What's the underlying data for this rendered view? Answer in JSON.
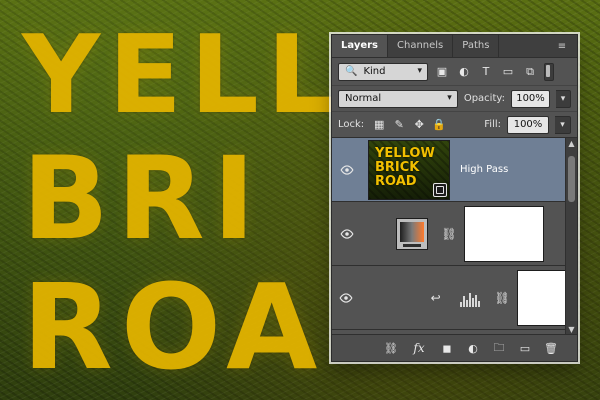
{
  "canvas": {
    "lines": [
      "YELL",
      "BRI",
      "ROA"
    ]
  },
  "panel": {
    "tabs": [
      {
        "label": "Layers"
      },
      {
        "label": "Channels"
      },
      {
        "label": "Paths"
      }
    ],
    "filter": {
      "kind_label": "Kind"
    },
    "blend": {
      "mode": "Normal",
      "opacity_label": "Opacity:",
      "opacity_value": "100%"
    },
    "lock": {
      "label": "Lock:",
      "fill_label": "Fill:",
      "fill_value": "100%"
    },
    "layers": [
      {
        "name": "High Pass",
        "thumb_text_lines": [
          "YELLOW",
          "BRICK",
          "ROAD"
        ]
      },
      {
        "name": ""
      },
      {
        "name": ""
      }
    ]
  },
  "colors": {
    "panel_bg": "#535353",
    "selected_row": "#6f7f95",
    "canvas_text": "#e2b300"
  },
  "icons": {
    "panel_menu": "panel-menu-icon",
    "filter_icons": [
      "image-filter-icon",
      "adjustment-filter-icon",
      "type-filter-icon",
      "shape-filter-icon",
      "smartobject-filter-icon"
    ],
    "lock_icons": [
      "lock-transparent-pixels-icon",
      "lock-image-pixels-icon",
      "lock-position-icon",
      "lock-all-icon"
    ],
    "toolbar": [
      "link-layers-icon",
      "fx-icon",
      "add-mask-icon",
      "new-fill-adjustment-icon",
      "new-group-icon",
      "new-layer-icon",
      "delete-layer-icon"
    ]
  }
}
